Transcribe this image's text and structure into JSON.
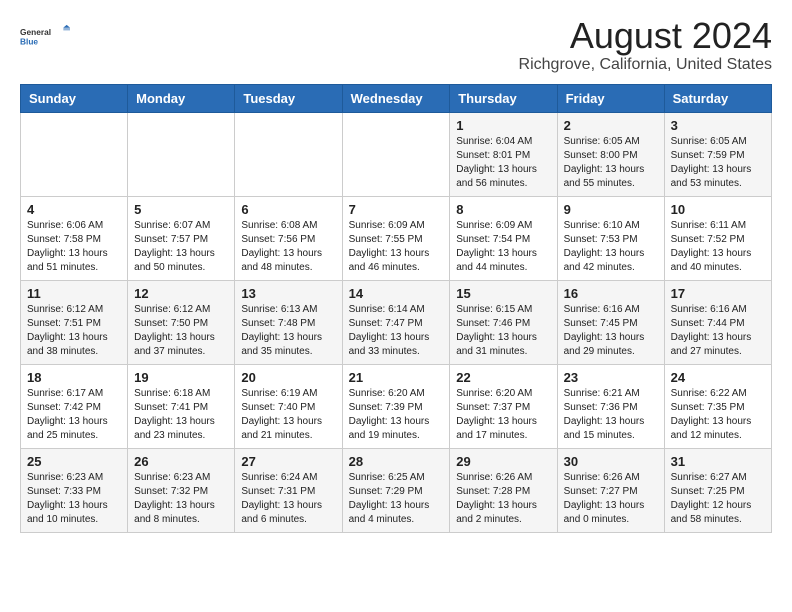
{
  "header": {
    "logo_general": "General",
    "logo_blue": "Blue",
    "main_title": "August 2024",
    "subtitle": "Richgrove, California, United States"
  },
  "days_of_week": [
    "Sunday",
    "Monday",
    "Tuesday",
    "Wednesday",
    "Thursday",
    "Friday",
    "Saturday"
  ],
  "weeks": [
    [
      {
        "day": "",
        "info": ""
      },
      {
        "day": "",
        "info": ""
      },
      {
        "day": "",
        "info": ""
      },
      {
        "day": "",
        "info": ""
      },
      {
        "day": "1",
        "info": "Sunrise: 6:04 AM\nSunset: 8:01 PM\nDaylight: 13 hours\nand 56 minutes."
      },
      {
        "day": "2",
        "info": "Sunrise: 6:05 AM\nSunset: 8:00 PM\nDaylight: 13 hours\nand 55 minutes."
      },
      {
        "day": "3",
        "info": "Sunrise: 6:05 AM\nSunset: 7:59 PM\nDaylight: 13 hours\nand 53 minutes."
      }
    ],
    [
      {
        "day": "4",
        "info": "Sunrise: 6:06 AM\nSunset: 7:58 PM\nDaylight: 13 hours\nand 51 minutes."
      },
      {
        "day": "5",
        "info": "Sunrise: 6:07 AM\nSunset: 7:57 PM\nDaylight: 13 hours\nand 50 minutes."
      },
      {
        "day": "6",
        "info": "Sunrise: 6:08 AM\nSunset: 7:56 PM\nDaylight: 13 hours\nand 48 minutes."
      },
      {
        "day": "7",
        "info": "Sunrise: 6:09 AM\nSunset: 7:55 PM\nDaylight: 13 hours\nand 46 minutes."
      },
      {
        "day": "8",
        "info": "Sunrise: 6:09 AM\nSunset: 7:54 PM\nDaylight: 13 hours\nand 44 minutes."
      },
      {
        "day": "9",
        "info": "Sunrise: 6:10 AM\nSunset: 7:53 PM\nDaylight: 13 hours\nand 42 minutes."
      },
      {
        "day": "10",
        "info": "Sunrise: 6:11 AM\nSunset: 7:52 PM\nDaylight: 13 hours\nand 40 minutes."
      }
    ],
    [
      {
        "day": "11",
        "info": "Sunrise: 6:12 AM\nSunset: 7:51 PM\nDaylight: 13 hours\nand 38 minutes."
      },
      {
        "day": "12",
        "info": "Sunrise: 6:12 AM\nSunset: 7:50 PM\nDaylight: 13 hours\nand 37 minutes."
      },
      {
        "day": "13",
        "info": "Sunrise: 6:13 AM\nSunset: 7:48 PM\nDaylight: 13 hours\nand 35 minutes."
      },
      {
        "day": "14",
        "info": "Sunrise: 6:14 AM\nSunset: 7:47 PM\nDaylight: 13 hours\nand 33 minutes."
      },
      {
        "day": "15",
        "info": "Sunrise: 6:15 AM\nSunset: 7:46 PM\nDaylight: 13 hours\nand 31 minutes."
      },
      {
        "day": "16",
        "info": "Sunrise: 6:16 AM\nSunset: 7:45 PM\nDaylight: 13 hours\nand 29 minutes."
      },
      {
        "day": "17",
        "info": "Sunrise: 6:16 AM\nSunset: 7:44 PM\nDaylight: 13 hours\nand 27 minutes."
      }
    ],
    [
      {
        "day": "18",
        "info": "Sunrise: 6:17 AM\nSunset: 7:42 PM\nDaylight: 13 hours\nand 25 minutes."
      },
      {
        "day": "19",
        "info": "Sunrise: 6:18 AM\nSunset: 7:41 PM\nDaylight: 13 hours\nand 23 minutes."
      },
      {
        "day": "20",
        "info": "Sunrise: 6:19 AM\nSunset: 7:40 PM\nDaylight: 13 hours\nand 21 minutes."
      },
      {
        "day": "21",
        "info": "Sunrise: 6:20 AM\nSunset: 7:39 PM\nDaylight: 13 hours\nand 19 minutes."
      },
      {
        "day": "22",
        "info": "Sunrise: 6:20 AM\nSunset: 7:37 PM\nDaylight: 13 hours\nand 17 minutes."
      },
      {
        "day": "23",
        "info": "Sunrise: 6:21 AM\nSunset: 7:36 PM\nDaylight: 13 hours\nand 15 minutes."
      },
      {
        "day": "24",
        "info": "Sunrise: 6:22 AM\nSunset: 7:35 PM\nDaylight: 13 hours\nand 12 minutes."
      }
    ],
    [
      {
        "day": "25",
        "info": "Sunrise: 6:23 AM\nSunset: 7:33 PM\nDaylight: 13 hours\nand 10 minutes."
      },
      {
        "day": "26",
        "info": "Sunrise: 6:23 AM\nSunset: 7:32 PM\nDaylight: 13 hours\nand 8 minutes."
      },
      {
        "day": "27",
        "info": "Sunrise: 6:24 AM\nSunset: 7:31 PM\nDaylight: 13 hours\nand 6 minutes."
      },
      {
        "day": "28",
        "info": "Sunrise: 6:25 AM\nSunset: 7:29 PM\nDaylight: 13 hours\nand 4 minutes."
      },
      {
        "day": "29",
        "info": "Sunrise: 6:26 AM\nSunset: 7:28 PM\nDaylight: 13 hours\nand 2 minutes."
      },
      {
        "day": "30",
        "info": "Sunrise: 6:26 AM\nSunset: 7:27 PM\nDaylight: 13 hours\nand 0 minutes."
      },
      {
        "day": "31",
        "info": "Sunrise: 6:27 AM\nSunset: 7:25 PM\nDaylight: 12 hours\nand 58 minutes."
      }
    ]
  ]
}
